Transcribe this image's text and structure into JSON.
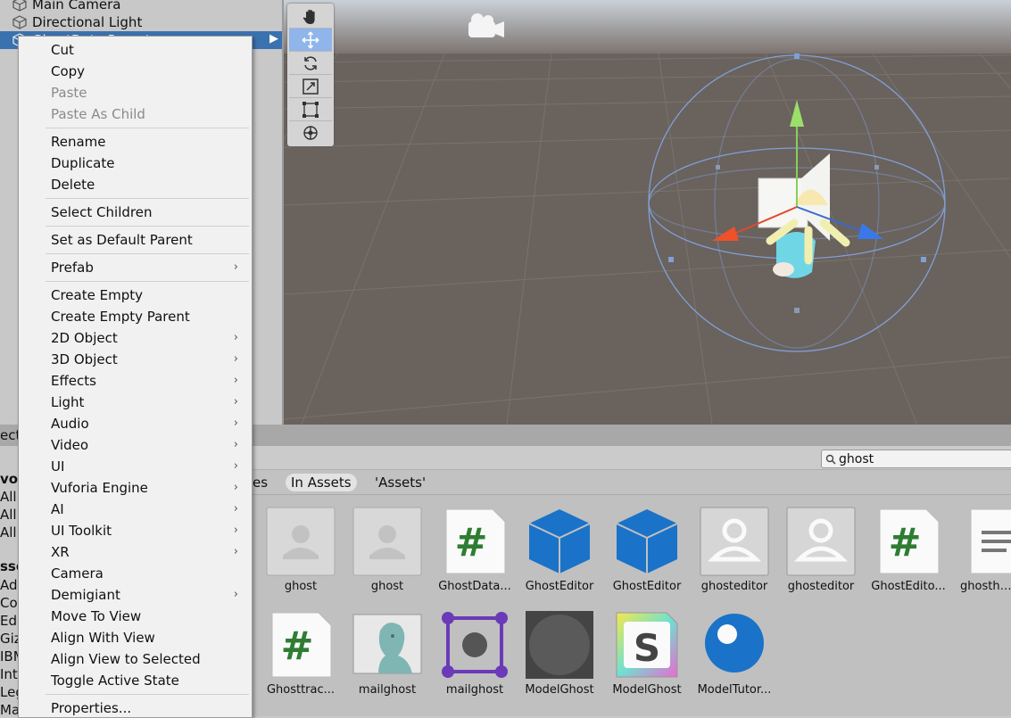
{
  "hierarchy": {
    "items": [
      {
        "label": "Main Camera"
      },
      {
        "label": "Directional Light"
      },
      {
        "label": "GhostData Parent"
      }
    ]
  },
  "context_menu": {
    "items": [
      {
        "label": "Cut",
        "enabled": true
      },
      {
        "label": "Copy",
        "enabled": true
      },
      {
        "label": "Paste",
        "enabled": false
      },
      {
        "label": "Paste As Child",
        "enabled": false
      },
      {
        "label": "Rename",
        "enabled": true
      },
      {
        "label": "Duplicate",
        "enabled": true
      },
      {
        "label": "Delete",
        "enabled": true
      },
      {
        "label": "Select Children",
        "enabled": true
      },
      {
        "label": "Set as Default Parent",
        "enabled": true
      },
      {
        "label": "Prefab",
        "submenu": true
      },
      {
        "label": "Create Empty"
      },
      {
        "label": "Create Empty Parent"
      },
      {
        "label": "2D Object",
        "submenu": true
      },
      {
        "label": "3D Object",
        "submenu": true
      },
      {
        "label": "Effects",
        "submenu": true
      },
      {
        "label": "Light",
        "submenu": true
      },
      {
        "label": "Audio",
        "submenu": true
      },
      {
        "label": "Video",
        "submenu": true
      },
      {
        "label": "UI",
        "submenu": true
      },
      {
        "label": "Vuforia Engine",
        "submenu": true
      },
      {
        "label": "AI",
        "submenu": true
      },
      {
        "label": "UI Toolkit",
        "submenu": true
      },
      {
        "label": "XR",
        "submenu": true
      },
      {
        "label": "Camera"
      },
      {
        "label": "Demigiant",
        "submenu": true
      },
      {
        "label": "Move To View"
      },
      {
        "label": "Align With View"
      },
      {
        "label": "Align View to Selected"
      },
      {
        "label": "Toggle Active State"
      },
      {
        "label": "Properties..."
      }
    ],
    "submenu_arrow": "›"
  },
  "project": {
    "tab_partial": "ect",
    "search_value": "ghost",
    "filters": [
      "es",
      "In Assets",
      "'Assets'"
    ],
    "left_panel": [
      "vo",
      "All",
      "All",
      "All",
      "sse",
      "Ad",
      "Co",
      "Edi",
      "Giz",
      "IBM",
      "Inte",
      "Leg",
      "Ma"
    ],
    "assets": [
      {
        "label": "ghost",
        "icon": "prefab-gray-icon"
      },
      {
        "label": "ghost",
        "icon": "prefab-gray-icon"
      },
      {
        "label": "GhostData...",
        "icon": "csharp-script-icon"
      },
      {
        "label": "GhostEditor",
        "icon": "blue-cube-icon"
      },
      {
        "label": "GhostEditor",
        "icon": "blue-cube-icon"
      },
      {
        "label": "ghosteditor",
        "icon": "person-icon"
      },
      {
        "label": "ghosteditor",
        "icon": "person-icon"
      },
      {
        "label": "GhostEdito...",
        "icon": "csharp-script-icon"
      },
      {
        "label": "ghosthan",
        "icon": "text-document-icon"
      },
      {
        "label": "Ghosttrac...",
        "icon": "csharp-script-icon"
      },
      {
        "label": "mailghost",
        "icon": "face-mesh-icon"
      },
      {
        "label": "mailghost",
        "icon": "bounding-box-icon"
      },
      {
        "label": "ModelGhost",
        "icon": "gray-sphere-icon"
      },
      {
        "label": "ModelGhost",
        "icon": "shader-graph-icon"
      },
      {
        "label": "ModelTutor...",
        "icon": "blue-circle-icon"
      }
    ]
  },
  "colors": {
    "scene_ground": "#6a625d",
    "selection": "#3a72b0",
    "script_green": "#2e7d32",
    "prefab_blue": "#1a73c8"
  }
}
